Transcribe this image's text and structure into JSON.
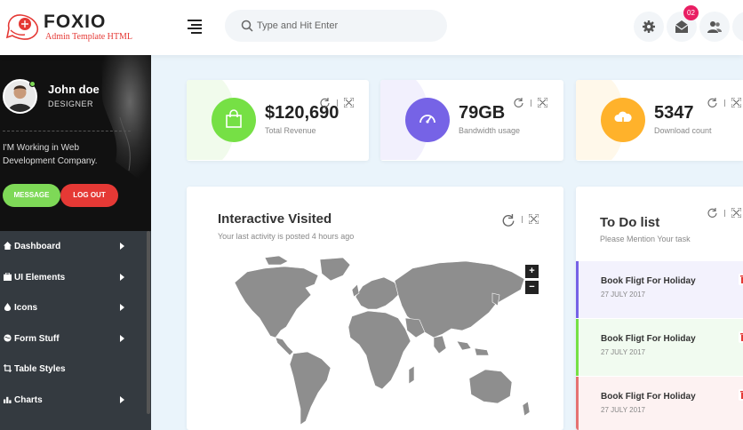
{
  "app": {
    "logo_title": "FOXIO",
    "logo_subtitle": "Admin Template HTML"
  },
  "header": {
    "search_placeholder": "Type and Hit Enter",
    "mail_badge": "02"
  },
  "profile": {
    "name": "John doe",
    "role": "DESIGNER",
    "bio": "I'M Working in Web Development Company.",
    "message_label": "MESSAGE",
    "logout_label": "LOG OUT"
  },
  "sidebar": {
    "items": [
      {
        "label": "Dashboard",
        "icon": "home-icon"
      },
      {
        "label": "UI Elements",
        "icon": "briefcase-icon"
      },
      {
        "label": "Icons",
        "icon": "drop-icon"
      },
      {
        "label": "Form Stuff",
        "icon": "globe-icon"
      },
      {
        "label": "Table Styles",
        "icon": "crop-icon"
      },
      {
        "label": "Charts",
        "icon": "bar-chart-icon"
      }
    ]
  },
  "stats": [
    {
      "value": "$120,690",
      "label": "Total Revenue",
      "color": "#76e045",
      "icon": "shopping-bag-icon"
    },
    {
      "value": "79GB",
      "label": "Bandwidth usage",
      "color": "#7663e6",
      "icon": "speedometer-icon"
    },
    {
      "value": "5347",
      "label": "Download count",
      "color": "#ffb22b",
      "icon": "cloud-download-icon"
    }
  ],
  "map_card": {
    "title": "Interactive Visited",
    "subtitle": "Your last activity is posted 4 hours ago",
    "zoom_in": "+",
    "zoom_out": "−"
  },
  "todo_card": {
    "title": "To Do list",
    "subtitle": "Please Mention Your task",
    "items": [
      {
        "title": "Book Fligt For Holiday",
        "date": "27 JULY 2017",
        "accent": "#7663e6",
        "bg": "#f3f2fd"
      },
      {
        "title": "Book Fligt For Holiday",
        "date": "27 JULY 2017",
        "accent": "#76e045",
        "bg": "#f1fbf0"
      },
      {
        "title": "Book Fligt For Holiday",
        "date": "27 JULY 2017",
        "accent": "#e57373",
        "bg": "#fdf2f2"
      }
    ]
  },
  "colors": {
    "accent_red": "#e53935",
    "sidebar_bg": "#343a40",
    "page_bg": "#eaf4fb"
  }
}
